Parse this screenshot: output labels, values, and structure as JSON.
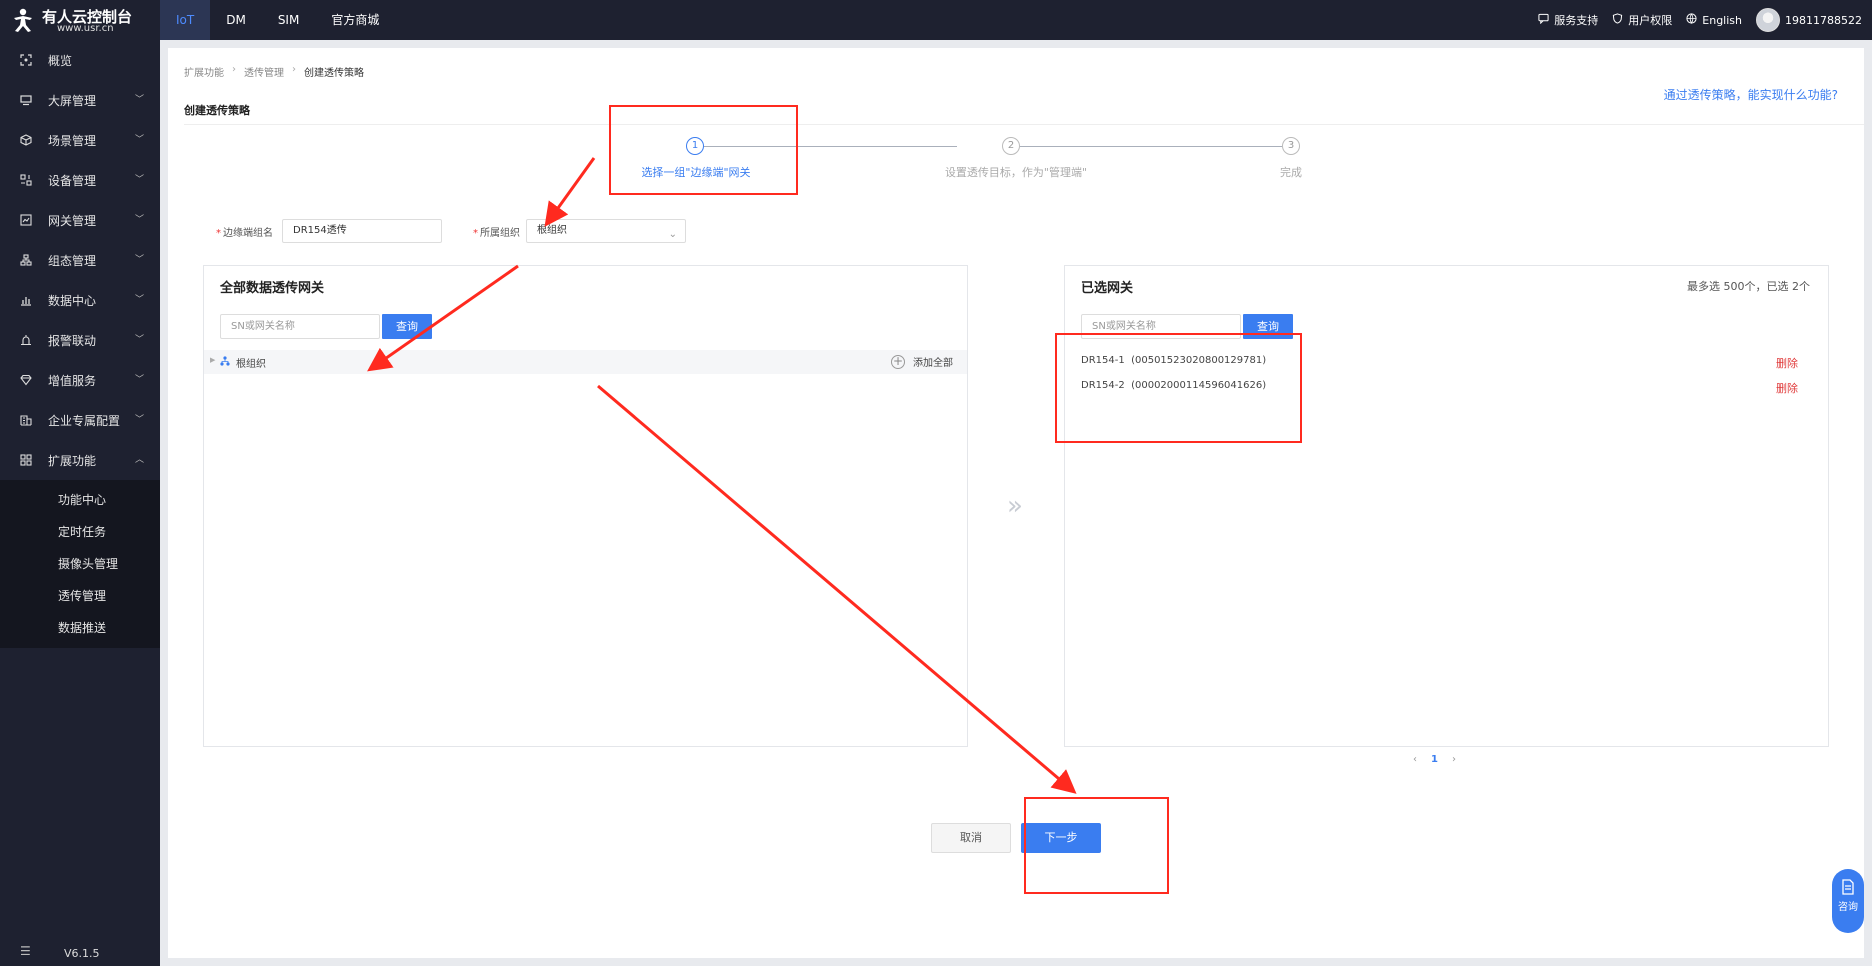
{
  "brand": {
    "title": "有人云控制台",
    "url": "www.usr.cn"
  },
  "top_nav": {
    "tabs": [
      "IoT",
      "DM",
      "SIM",
      "官方商城"
    ],
    "active": "IoT",
    "right": {
      "support": "服务支持",
      "permissions": "用户权限",
      "language": "English",
      "user": "19811788522"
    }
  },
  "sidebar": {
    "items": [
      {
        "label": "概览",
        "icon": "overview-icon"
      },
      {
        "label": "大屏管理",
        "icon": "screen-icon"
      },
      {
        "label": "场景管理",
        "icon": "scene-icon"
      },
      {
        "label": "设备管理",
        "icon": "device-icon"
      },
      {
        "label": "网关管理",
        "icon": "gateway-icon"
      },
      {
        "label": "组态管理",
        "icon": "configuration-icon"
      },
      {
        "label": "数据中心",
        "icon": "data-center-icon"
      },
      {
        "label": "报警联动",
        "icon": "alarm-icon"
      },
      {
        "label": "增值服务",
        "icon": "diamond-icon"
      },
      {
        "label": "企业专属配置",
        "icon": "enterprise-icon"
      },
      {
        "label": "扩展功能",
        "icon": "extension-icon"
      }
    ],
    "submenu": [
      "功能中心",
      "定时任务",
      "摄像头管理",
      "透传管理",
      "数据推送"
    ],
    "version": "V6.1.5"
  },
  "breadcrumb": [
    "扩展功能",
    "透传管理",
    "创建透传策略"
  ],
  "page": {
    "title": "创建透传策略",
    "help_link": "通过透传策略，能实现什么功能?"
  },
  "steps": [
    {
      "num": "1",
      "label": "选择一组\"边缘端\"网关",
      "active": true
    },
    {
      "num": "2",
      "label": "设置透传目标，作为\"管理端\"",
      "active": false
    },
    {
      "num": "3",
      "label": "完成",
      "active": false
    }
  ],
  "form": {
    "edge_group_label": "边缘端组名",
    "edge_group_value": "DR154透传",
    "org_label": "所属组织",
    "org_value": "根组织"
  },
  "left_panel": {
    "title": "全部数据透传网关",
    "search_placeholder": "SN或网关名称",
    "search_button": "查询",
    "tree_root": "根组织",
    "add_all": "添加全部"
  },
  "right_panel": {
    "title": "已选网关",
    "count_text": "最多选 500个，已选 2个",
    "search_placeholder": "SN或网关名称",
    "search_button": "查询",
    "gateways": [
      {
        "name": "DR154-1",
        "sn": "(00501523020800129781)"
      },
      {
        "name": "DR154-2",
        "sn": "(00002000114596041626)"
      }
    ],
    "delete_label": "删除",
    "pagination": {
      "prev": "‹",
      "page": "1",
      "next": "›"
    }
  },
  "buttons": {
    "cancel": "取消",
    "next": "下一步"
  },
  "consult": "咨询",
  "colors": {
    "accent": "#3a7df0",
    "danger": "#e03a3a",
    "sidebar_bg": "#1e2130",
    "annotation": "#ff2a1f"
  }
}
